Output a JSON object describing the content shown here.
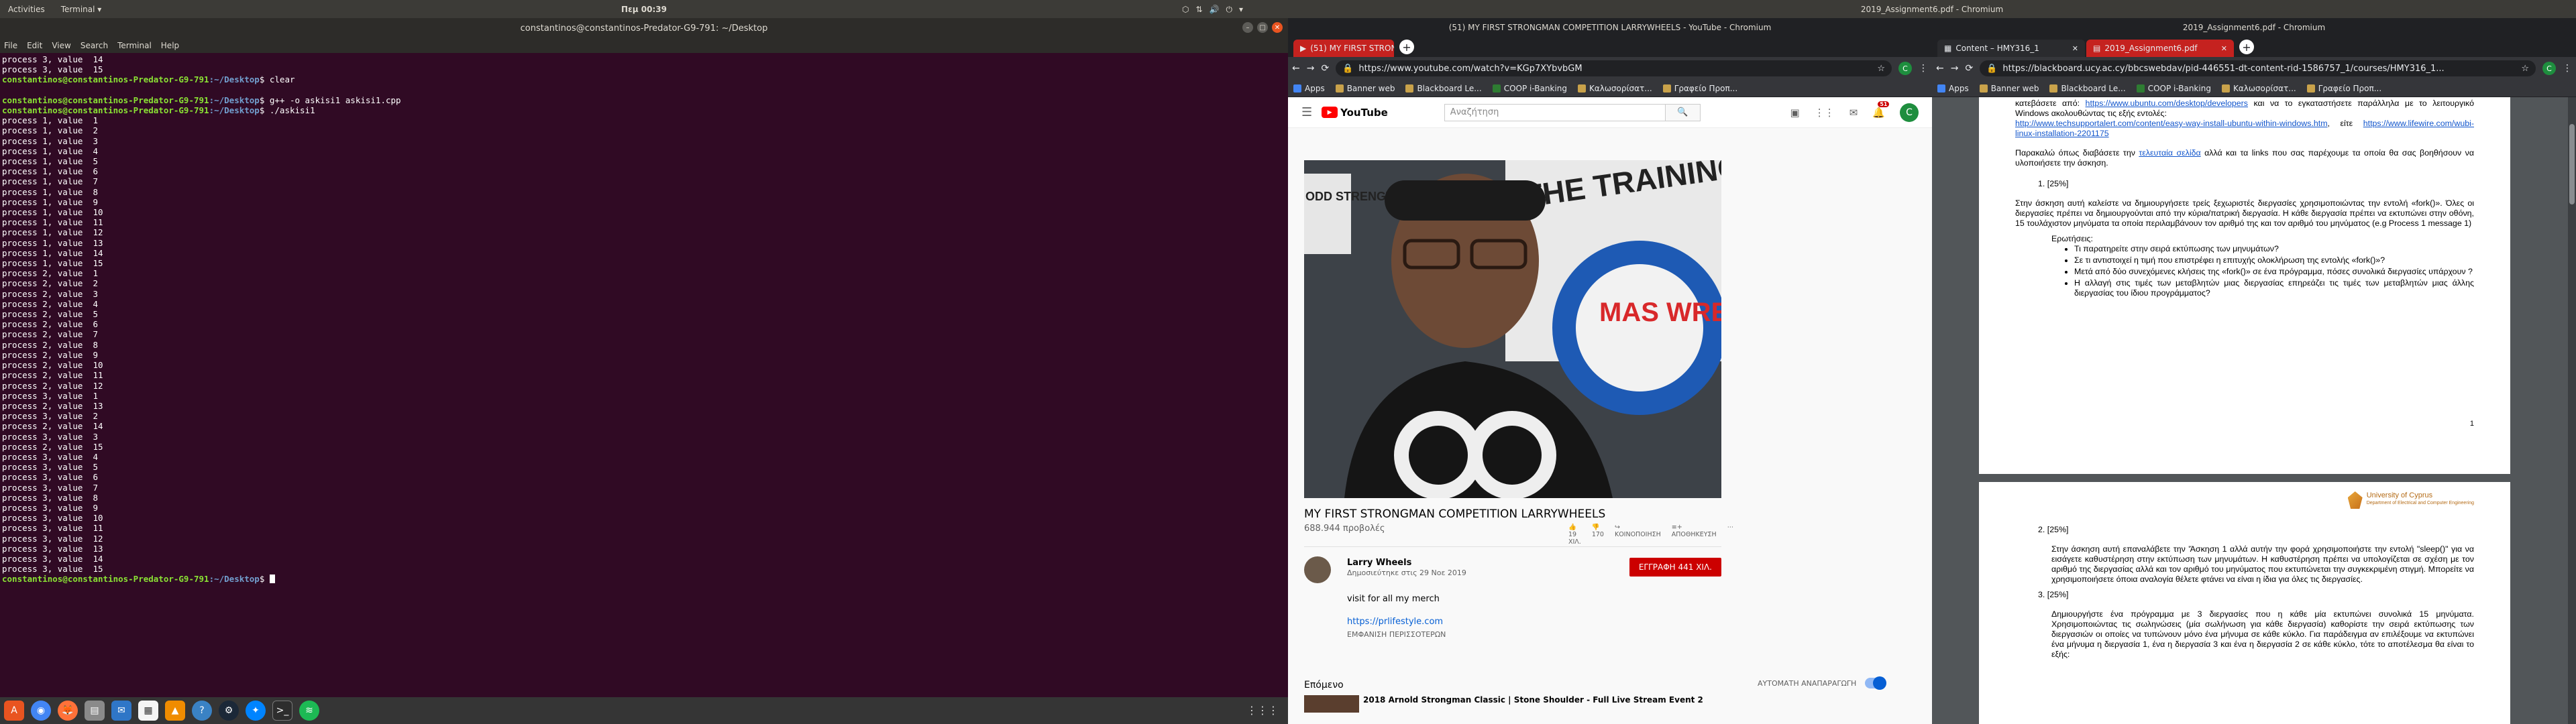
{
  "topbar": {
    "activities": "Activities",
    "app_menu": "Terminal ▾",
    "clock": "Πεμ 00:39",
    "right_title": "2019_Assignment6.pdf - Chromium"
  },
  "terminal": {
    "title": "constantinos@constantinos-Predator-G9-791: ~/Desktop",
    "menu": [
      "File",
      "Edit",
      "View",
      "Search",
      "Terminal",
      "Help"
    ],
    "prompt_user": "constantinos@constantinos-Predator-G9-791",
    "prompt_path": ":~/Desktop",
    "lines_top": [
      "process 3, value  14",
      "process 3, value  15"
    ],
    "cmd_clear": "$ clear",
    "cmd_compile": "$ g++ -o askisi1 askisi1.cpp",
    "cmd_run": "$ ./askisi1",
    "output": [
      "process 1, value  1",
      "process 1, value  2",
      "process 1, value  3",
      "process 1, value  4",
      "process 1, value  5",
      "process 1, value  6",
      "process 1, value  7",
      "process 1, value  8",
      "process 1, value  9",
      "process 1, value  10",
      "process 1, value  11",
      "process 1, value  12",
      "process 1, value  13",
      "process 1, value  14",
      "process 1, value  15",
      "process 2, value  1",
      "process 2, value  2",
      "process 2, value  3",
      "process 2, value  4",
      "process 2, value  5",
      "process 2, value  6",
      "process 2, value  7",
      "process 2, value  8",
      "process 2, value  9",
      "process 2, value  10",
      "process 2, value  11",
      "process 2, value  12",
      "process 3, value  1",
      "process 2, value  13",
      "process 3, value  2",
      "process 2, value  14",
      "process 3, value  3",
      "process 2, value  15",
      "process 3, value  4",
      "process 3, value  5",
      "process 3, value  6",
      "process 3, value  7",
      "process 3, value  8",
      "process 3, value  9",
      "process 3, value  10",
      "process 3, value  11",
      "process 3, value  12",
      "process 3, value  13",
      "process 3, value  14",
      "process 3, value  15"
    ],
    "cmd_last": "$ "
  },
  "youtube_window": {
    "title": "(51) MY FIRST STRONGMAN COMPETITION LARRYWHEELS - YouTube - Chromium",
    "tab_label": "(51) MY FIRST STRONGM",
    "url": "https://www.youtube.com/watch?v=KGp7XYbvbGM",
    "bookmarks": [
      "Apps",
      "Banner web",
      "Blackboard Le...",
      "COOP i-Banking",
      "Καλωσορίσατ...",
      "Γραφείο Προπ..."
    ],
    "search_placeholder": "Αναζήτηση",
    "notif_count": "51",
    "account_letter": "C",
    "logo_text": "YouTube",
    "video_title": "MY FIRST STRONGMAN COMPETITION LARRYWHEELS",
    "views": "688.944 προβολές",
    "likes": "19 ΧΙΛ.",
    "dislikes": "170",
    "share": "ΚΟΙΝΟΠΟΙΗΣΗ",
    "save": "ΑΠΟΘΗΚΕΥΣΗ",
    "channel_name": "Larry Wheels",
    "published": "Δημοσιεύτηκε στις 29 Νοε 2019",
    "subscribe": "ΕΓΓΡΑΦΗ 441 ΧΙΛ.",
    "desc_line1": "visit for all my merch",
    "desc_link": "https://prlifestyle.com",
    "show_more": "ΕΜΦΑΝΙΣΗ ΠΕΡΙΣΣΟΤΕΡΩΝ",
    "up_next": "Επόμενο",
    "autoplay": "ΑΥΤΟΜΑΤΗ ΑΝΑΠΑΡΑΓΩΓΗ",
    "next_video": "2018 Arnold Strongman Classic | Stone Shoulder - Full Live Stream Event 2",
    "banner_text_1": "THE TRAINING HALL",
    "banner_text_2": "MAS WRESTLING",
    "banner_text_3": "ODD STRENGTH"
  },
  "bb_window": {
    "title": "2019_Assignment6.pdf - Chromium",
    "tab1": "Content – HMY316_1",
    "tab2": "2019_Assignment6.pdf",
    "url": "https://blackboard.ucy.ac.cy/bbcswebdav/pid-446551-dt-content-rid-1586757_1/courses/HMY316_1...",
    "bookmarks": [
      "Apps",
      "Banner web",
      "Blackboard Le...",
      "COOP i-Banking",
      "Καλωσορίσατ...",
      "Γραφείο Προπ..."
    ],
    "page1_line1a": "κατεβάσετε από: ",
    "page1_link1": "https://www.ubuntu.com/desktop/developers",
    "page1_line1b": " και να το εγκαταστήσετε παράλληλα με το λειτουργικό Windows ακολουθώντας τις εξής εντολές:",
    "page1_link2": "http://www.techsupportalert.com/content/easy-way-install-ubuntu-within-windows.htm",
    "page1_line2": ", είτε ",
    "page1_link3": "https://www.lifewire.com/wubi-linux-installation-2201175",
    "page1_p2a": "Παρακαλώ όπως διαβάσετε την ",
    "page1_p2link": "τελευταία σελίδα",
    "page1_p2b": " αλλά και τα links που σας παρέχουμε τα οποία θα σας βοηθήσουν να υλοποιήσετε την άσκηση.",
    "q1_head": "1.   [25%]",
    "q1_text": "Στην άσκηση αυτή καλείστε να δημιουργήσετε τρείς ξεχωριστές διεργασίες χρησιμοποιώντας την εντολή «fork()». Όλες οι διεργασίες πρέπει να δημιουργούνται από την κύρια/πατρική διεργασία. Η κάθε διεργασία πρέπει να εκτυπώνει στην οθόνη, 15 τουλάχιστον μηνύματα τα οποία περιλαμβάνουν τον αριθμό της και τον αριθμό του μηνύματος (e.g Process 1 message 1)",
    "questions_label": "Ερωτήσεις:",
    "questions": [
      "Τι παρατηρείτε στην σειρά εκτύπωσης των μηνυμάτων?",
      "Σε τι αντιστοιχεί η τιμή που επιστρέφει η επιτυχής ολοκλήρωση της εντολής «fork()»?",
      "Μετά από δύο συνεχόμενες κλήσεις της «fork()» σε ένα πρόγραμμα, πόσες συνολικά διεργασίες υπάρχουν ?",
      "Η αλλαγή στις τιμές των μεταβλητών μιας διεργασίας επηρεάζει τις τιμές των μεταβλητών μιας άλλης διεργασίας του ίδιου προγράμματος?"
    ],
    "page_number": "1",
    "uc_name": "University of Cyprus",
    "uc_dept": "Department of Electrical and Computer Engineering",
    "q2_head": "2.   [25%]",
    "q2_text": "Στην άσκηση αυτή επαναλάβετε την 'Άσκηση 1 αλλά αυτήν την φορά χρησιμοποιήστε την εντολή \"sleep()\" για να εισάγετε καθυστέρηση στην εκτύπωση των μηνυμάτων. Η καθυστέρηση πρέπει να υπολογίζεται σε σχέση με τον αριθμό της διεργασίας αλλά και τον αριθμό του μηνύματος που εκτυπώνεται την συγκεκριμένη στιγμή. Μπορείτε να χρησιμοποιήσετε όποια αναλογία θέλετε φτάνει να είναι η ίδια για όλες τις διεργασίες.",
    "q3_head": "3.   [25%]",
    "q3_text": "Δημιουργήστε ένα πρόγραμμα με 3 διεργασίες που η κάθε μία εκτυπώνει συνολικά 15 μηνύματα. Χρησιμοποιώντας τις σωληνώσεις (μία σωλήνωση για κάθε διεργασία) καθορίστε την σειρά εκτύπωσης των διεργασιών οι οποίες να τυπώνουν μόνο ένα μήνυμα σε κάθε κύκλο. Για παράδειγμα αν επιλέξουμε να εκτυπώνει ένα μήνυμα η διεργασία 1, ένα η διεργασία 3 και ένα η διεργασία 2 σε κάθε κύκλο, τότε το αποτέλεσμα θα είναι το εξής:"
  },
  "dock": {
    "icons": [
      "ubuntu-software-icon",
      "chrome-icon",
      "firefox-icon",
      "files-icon",
      "thunderbird-icon",
      "libreoffice-icon",
      "vlc-icon",
      "help-icon",
      "steam-icon",
      "messenger-icon",
      "terminal-icon",
      "spotify-icon"
    ]
  }
}
